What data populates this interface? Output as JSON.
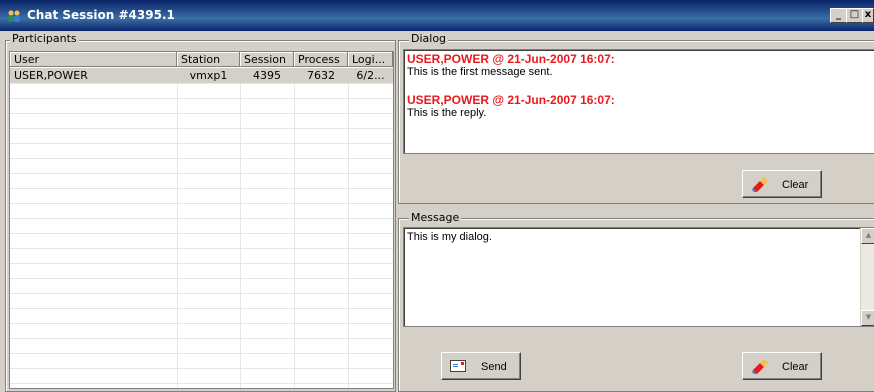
{
  "window": {
    "title": "Chat Session #4395.1",
    "controls": {
      "minimize": "_",
      "maximize": "□",
      "close": "x"
    }
  },
  "participants": {
    "group_label": "Participants",
    "columns": [
      "User",
      "Station",
      "Session",
      "Process",
      "Logi..."
    ],
    "rows": [
      {
        "user": "USER,POWER",
        "station": "vmxp1",
        "session": "4395",
        "process": "7632",
        "login": "6/2..."
      }
    ]
  },
  "dialog": {
    "group_label": "Dialog",
    "messages": [
      {
        "header": "USER,POWER @ 21-Jun-2007 16:07:",
        "text": "This is the first message sent."
      },
      {
        "header": "USER,POWER @ 21-Jun-2007 16:07:",
        "text": "This is the reply."
      }
    ],
    "clear_label": "Clear"
  },
  "message": {
    "group_label": "Message",
    "value": "This is my dialog.",
    "send_label": "Send",
    "clear_label": "Clear"
  },
  "colors": {
    "titlebar": "#0a246a",
    "message_header": "#e8191d",
    "window_bg": "#d4d0c8"
  },
  "icons": {
    "app": "people-icon",
    "clear": "eraser-icon",
    "send": "envelope-icon"
  }
}
